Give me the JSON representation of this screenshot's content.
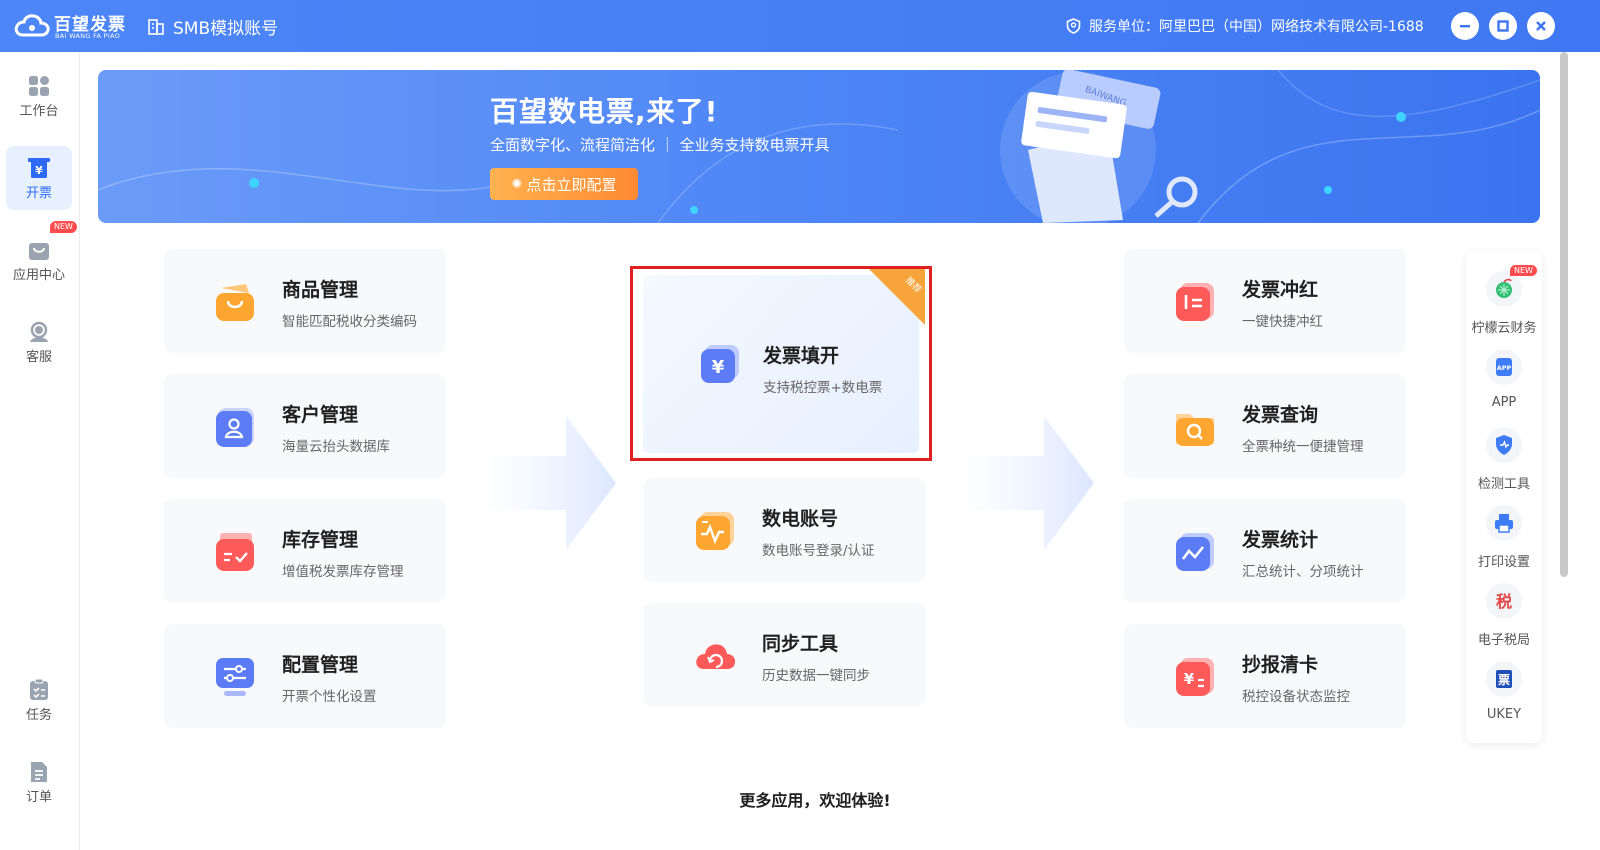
{
  "titlebar": {
    "logo_name": "百望发票",
    "logo_sub": "BAI WANG FA PIAO",
    "account": "SMB模拟账号",
    "service_label": "服务单位：阿里巴巴（中国）网络技术有限公司-1688"
  },
  "leftnav": {
    "items": [
      {
        "label": "工作台",
        "icon": "grid-icon"
      },
      {
        "label": "开票",
        "icon": "invoice-icon",
        "active": true
      },
      {
        "label": "应用中心",
        "icon": "bag-icon",
        "badge": "NEW"
      },
      {
        "label": "客服",
        "icon": "headset-icon"
      },
      {
        "label": "任务",
        "icon": "task-icon"
      },
      {
        "label": "订单",
        "icon": "order-icon"
      }
    ]
  },
  "banner": {
    "title": "百望数电票,来了!",
    "subtitle": "全面数字化、流程简洁化 ｜ 全业务支持数电票开具",
    "button": "点击立即配置",
    "art_text": "BAIWANG"
  },
  "cards": {
    "left": [
      {
        "title": "商品管理",
        "desc": "智能匹配税收分类编码",
        "icon": "product-icon",
        "color": "#ffa630"
      },
      {
        "title": "客户管理",
        "desc": "海量云抬头数据库",
        "icon": "customer-icon",
        "color": "#5b7cf5"
      },
      {
        "title": "库存管理",
        "desc": "增值税发票库存管理",
        "icon": "inventory-icon",
        "color": "#ff5a5a"
      },
      {
        "title": "配置管理",
        "desc": "开票个性化设置",
        "icon": "config-icon",
        "color": "#5b7cf5"
      }
    ],
    "center_feature": {
      "title": "发票填开",
      "desc": "支持税控票+数电票",
      "corner": "推荐",
      "icon": "yuan-icon",
      "color": "#5b7cf5"
    },
    "center": [
      {
        "title": "数电账号",
        "desc": "数电账号登录/认证",
        "icon": "pulse-icon",
        "color": "#ffa630"
      },
      {
        "title": "同步工具",
        "desc": "历史数据一键同步",
        "icon": "cloud-sync-icon",
        "color": "#ff5a5a"
      }
    ],
    "right": [
      {
        "title": "发票冲红",
        "desc": "一键快捷冲红",
        "icon": "redflush-icon",
        "color": "#ff5a5a"
      },
      {
        "title": "发票查询",
        "desc": "全票种统一便捷管理",
        "icon": "query-icon",
        "color": "#ffa630"
      },
      {
        "title": "发票统计",
        "desc": "汇总统计、分项统计",
        "icon": "stats-icon",
        "color": "#5b7cf5"
      },
      {
        "title": "抄报清卡",
        "desc": "税控设备状态监控",
        "icon": "clearcard-icon",
        "color": "#ff5a5a"
      }
    ]
  },
  "more": "更多应用，欢迎体验!",
  "rightbar": {
    "items": [
      {
        "label": "柠檬云财务",
        "badge": "NEW",
        "icon": "lemon-icon"
      },
      {
        "label": "APP",
        "icon": "app-icon",
        "icon_text": "APP"
      },
      {
        "label": "检测工具",
        "icon": "shield-check-icon"
      },
      {
        "label": "打印设置",
        "icon": "printer-icon"
      },
      {
        "label": "电子税局",
        "icon": "tax-icon",
        "icon_text": "税"
      },
      {
        "label": "UKEY",
        "icon": "ukey-icon",
        "icon_text": "票"
      }
    ]
  }
}
